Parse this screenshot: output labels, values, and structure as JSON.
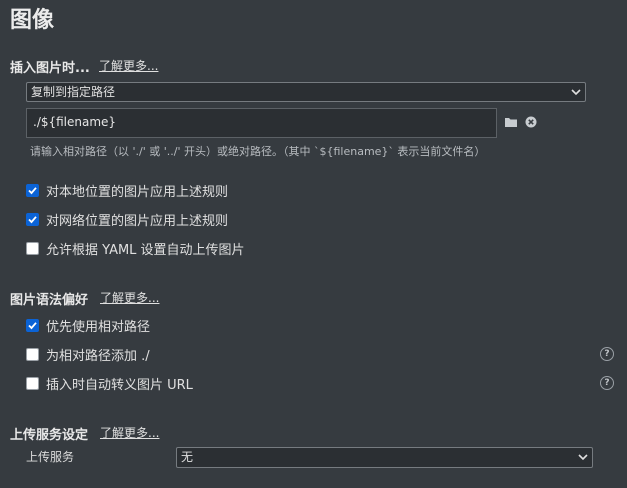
{
  "page": {
    "title": "图像"
  },
  "insert_image": {
    "title": "插入图片时...",
    "learn_more": "了解更多...",
    "action_select": "复制到指定路径",
    "path_value": "./${filename}",
    "hint": "请输入相对路径（以 './' 或 '../' 开头）或绝对路径。（其中 `${filename}` 表示当前文件名）",
    "checkboxes": [
      {
        "label": "对本地位置的图片应用上述规则",
        "checked": true
      },
      {
        "label": "对网络位置的图片应用上述规则",
        "checked": true
      },
      {
        "label": "允许根据 YAML 设置自动上传图片",
        "checked": false
      }
    ]
  },
  "syntax_pref": {
    "title": "图片语法偏好",
    "learn_more": "了解更多...",
    "checkboxes": [
      {
        "label": "优先使用相对路径",
        "checked": true
      },
      {
        "label": "为相对路径添加 ./",
        "checked": false
      },
      {
        "label": "插入时自动转义图片 URL",
        "checked": false
      }
    ]
  },
  "upload": {
    "title": "上传服务设定",
    "learn_more": "了解更多...",
    "service_label": "上传服务",
    "service_value": "无"
  },
  "icons": {
    "folder": "folder-icon",
    "clear": "clear-icon",
    "help": "help-icon",
    "checkmark": "checkmark-icon",
    "chevron": "chevron-down-icon"
  },
  "colors": {
    "background": "#363b40",
    "checkbox_checked": "#0b63d6",
    "input_bg": "#2b2f33"
  }
}
